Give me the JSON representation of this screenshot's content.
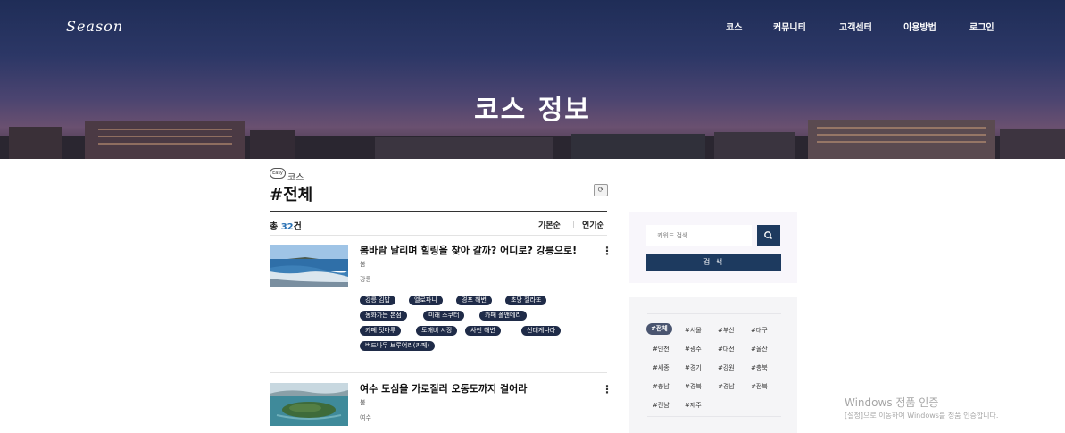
{
  "header": {
    "logo": "Season",
    "nav": [
      "코스",
      "커뮤니티",
      "고객센터",
      "이용방법",
      "로그인"
    ],
    "hero_title": "코스 정보"
  },
  "main": {
    "badge": "Easy",
    "breadcrumb": "코스",
    "heading": "#전체",
    "total_prefix": "총",
    "total_count": "32",
    "total_suffix": "건",
    "sort_basic": "기본순",
    "sort_popular": "인기순",
    "courses": [
      {
        "title": "봄바람 날리며 힐링을 찾아 갈까? 어디로? 강릉으로!",
        "season": "봄",
        "region": "강릉",
        "tags": [
          "강릉 김밥",
          "엘로파니",
          "경포 해변",
          "초당 젤라또",
          "동화가든 본점",
          "미래 스쿠터",
          "카페 폴앤메리",
          "카페 텃마루",
          "도깨비 시장",
          "사천 해변",
          "신대게나라",
          "버드나무 브루어리(카페)"
        ]
      },
      {
        "title": "여수 도심을 가로질러 오동도까지 걸어라",
        "season": "봄",
        "region": "여수",
        "tags": []
      }
    ]
  },
  "sidebar": {
    "keyword_placeholder": "키워드 검색",
    "search_label": "검 색",
    "regions": [
      "#전체",
      "#서울",
      "#부산",
      "#대구",
      "#인천",
      "#광주",
      "#대전",
      "#울산",
      "#세종",
      "#경기",
      "#강원",
      "#충북",
      "#충남",
      "#경북",
      "#경남",
      "#전북",
      "#전남",
      "#제주"
    ]
  },
  "watermark": {
    "line1": "Windows 정품 인증",
    "line2": "[설정]으로 이동하여 Windows를 정품 인증합니다."
  },
  "colors": {
    "navy": "#1d3a5f",
    "tag_bg": "#1f2b48",
    "count_blue": "#2a72b5"
  }
}
